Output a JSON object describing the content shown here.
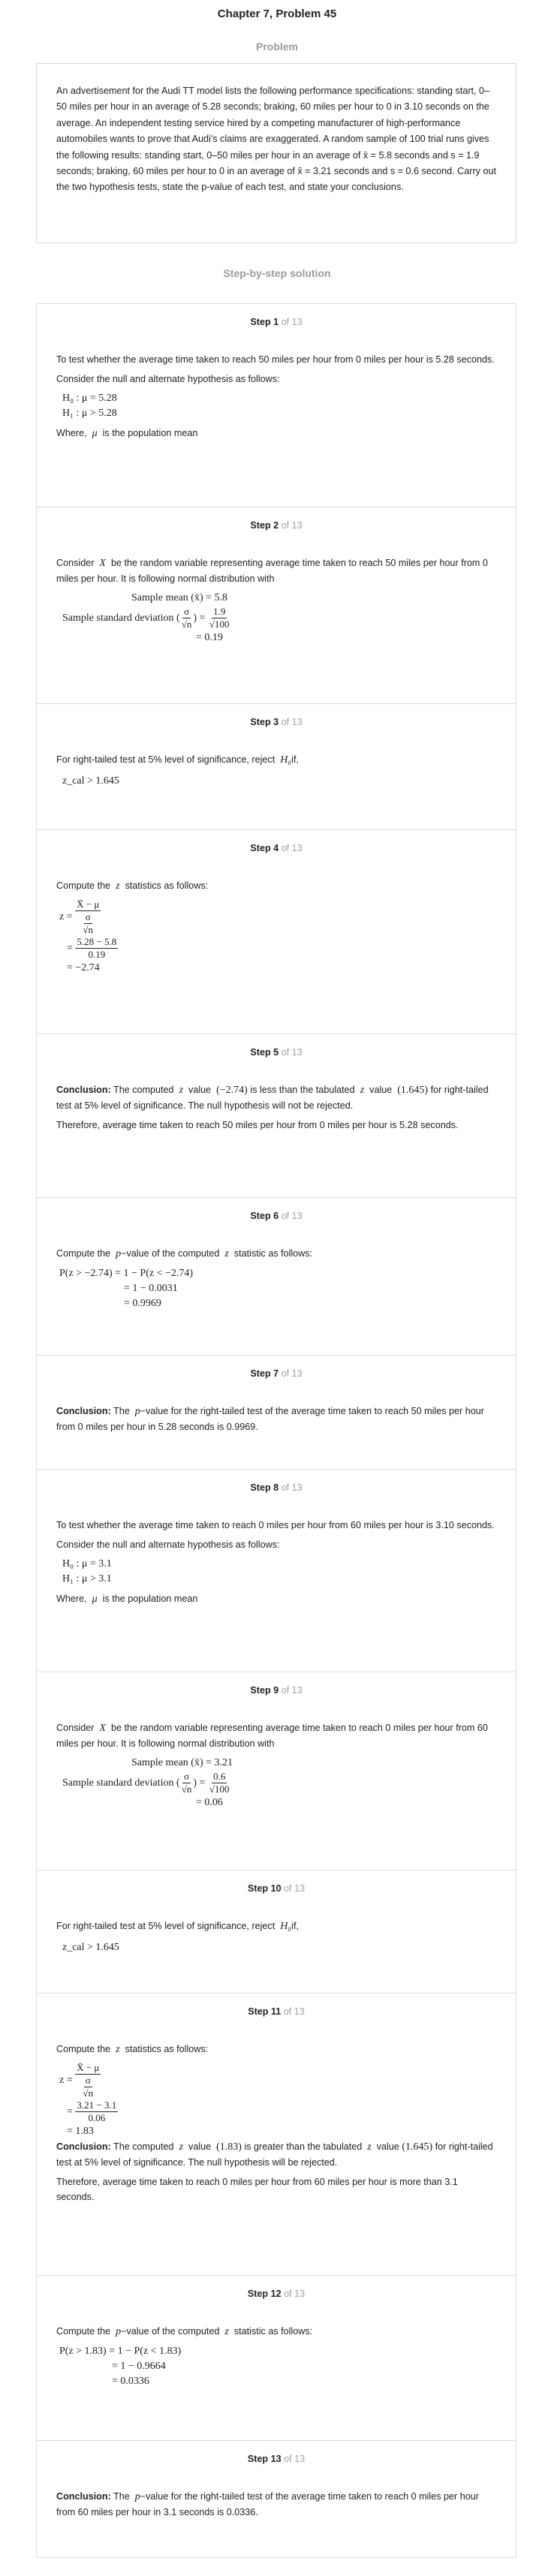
{
  "header": {
    "title": "Chapter 7, Problem 45",
    "problem_label": "Problem"
  },
  "problem": {
    "text": "An advertisement for the Audi TT model lists the following performance specifications: standing start, 0–50 miles per hour in an average of 5.28 seconds; braking, 60 miles per hour to 0 in 3.10 seconds on the average. An independent testing service hired by a competing manufacturer of high-performance automobiles wants to prove that Audi's claims are exaggerated. A random sample of 100 trial runs gives the following results: standing start, 0–50 miles per hour in an average of  x̄  = 5.8 seconds and s = 1.9 seconds; braking, 60 miles per hour to 0 in an average of  x̄  = 3.21 seconds and s = 0.6 second. Carry out the two hypothesis tests, state the p-value of each test, and state your conclusions."
  },
  "solution_label": "Step-by-step solution",
  "steps": [
    {
      "label": "Step 1",
      "of": "of 13",
      "t1": "To test whether the average time taken to reach 50 miles per hour from 0 miles per hour is 5.28 seconds.",
      "t2": "Consider the null and alternate hypothesis as follows:",
      "m1": "H₀ : μ = 5.28",
      "m2": "H₁ : μ > 5.28",
      "t3": "Where,",
      "m3": "μ",
      "t4": "is the population mean"
    },
    {
      "label": "Step 2",
      "of": "of 13",
      "t1": "Consider",
      "m1": "X",
      "t2": "be the random variable representing average time taken to reach 50 miles per hour from 0 miles per hour. It is following normal distribution with",
      "m2": "Sample mean (x̄) = 5.8",
      "m3": "Sample standard deviation",
      "num": "1.9",
      "den": "√100",
      "m4": "= 0.19"
    },
    {
      "label": "Step 3",
      "of": "of 13",
      "t1": "For right-tailed test at 5% level of significance, reject",
      "m1": "H₀",
      "t2": "if,",
      "m2": "z_cal > 1.645"
    },
    {
      "label": "Step 4",
      "of": "of 13",
      "t1": "Compute the",
      "m1": "z",
      "t2": "statistics as follows:",
      "num": "5.28 − 5.8",
      "den": "0.19",
      "m2": "= −2.74"
    },
    {
      "label": "Step 5",
      "of": "of 13",
      "b": "Conclusion:",
      "t1": "The computed",
      "m1": "z",
      "t2": "value",
      "m2": "(−2.74)",
      "t3": "is less than the tabulated",
      "m3": "z",
      "t4": "value",
      "m4": "(1.645)",
      "t5": "for right-tailed test at 5% level of significance. The null hypothesis will not be rejected.",
      "t6": "Therefore, average time taken to reach 50 miles per hour from 0 miles per hour is 5.28 seconds."
    },
    {
      "label": "Step 6",
      "of": "of 13",
      "t1": "Compute the",
      "m1": "p",
      "t2": "−value of the computed",
      "m2": "z",
      "t3": "statistic as follows:",
      "m3": "P(z > −2.74) = 1 − P(z < −2.74)",
      "m4": "= 1 − 0.0031",
      "m5": "= 0.9969"
    },
    {
      "label": "Step 7",
      "of": "of 13",
      "b": "Conclusion:",
      "t1": "The",
      "m1": "p",
      "t2": "−value for the right-tailed test of the average time taken to reach 50 miles per hour from 0 miles per hour in 5.28 seconds is 0.9969."
    },
    {
      "label": "Step 8",
      "of": "of 13",
      "t1": "To test whether the average time taken to reach 0 miles per hour from 60 miles per hour is 3.10 seconds.",
      "t2": "Consider the null and alternate hypothesis as follows:",
      "m1": "H₀ : μ = 3.1",
      "m2": "H₁ : μ > 3.1",
      "t3": "Where,",
      "m3": "μ",
      "t4": "is the population mean"
    },
    {
      "label": "Step 9",
      "of": "of 13",
      "t1": "Consider",
      "m1": "X",
      "t2": "be the random variable representing average time taken to reach 0 miles per hour from 60 miles per hour. It is following normal distribution with",
      "m2": "Sample mean (x̄) = 3.21",
      "m3": "Sample standard deviation",
      "num": "0.6",
      "den": "√100",
      "m4": "= 0.06"
    },
    {
      "label": "Step 10",
      "of": "of 13",
      "t1": "For right-tailed test at 5% level of significance, reject",
      "m1": "H₀",
      "t2": "if,",
      "m2": "z_cal > 1.645"
    },
    {
      "label": "Step 11",
      "of": "of 13",
      "t1": "Compute the",
      "m1": "z",
      "t2": "statistics as follows:",
      "num": "3.21 − 3.1",
      "den": "0.06",
      "m2": "= 1.83",
      "b": "Conclusion:",
      "t3": "The computed",
      "m3": "z",
      "t4": "value",
      "m4": "(1.83)",
      "t5": "is greater than the tabulated",
      "m5": "z",
      "t6": "value",
      "m6": "(1.645)",
      "t7": "for right-tailed test at 5% level of significance. The null hypothesis will be rejected.",
      "t8": "Therefore, average time taken to reach 0 miles per hour from 60 miles per hour is more than 3.1 seconds."
    },
    {
      "label": "Step 12",
      "of": "of 13",
      "t1": "Compute the",
      "m1": "p",
      "t2": "−value of the computed",
      "m2": "z",
      "t3": "statistic as follows:",
      "m3": "P(z > 1.83) = 1 − P(z < 1.83)",
      "m4": "= 1 − 0.9664",
      "m5": "= 0.0336"
    },
    {
      "label": "Step 13",
      "of": "of 13",
      "b": "Conclusion:",
      "t1": "The",
      "m1": "p",
      "t2": "−value for the right-tailed test of the average time taken to reach 0 miles per hour from 60 miles per hour in 3.1 seconds is 0.0336."
    }
  ]
}
